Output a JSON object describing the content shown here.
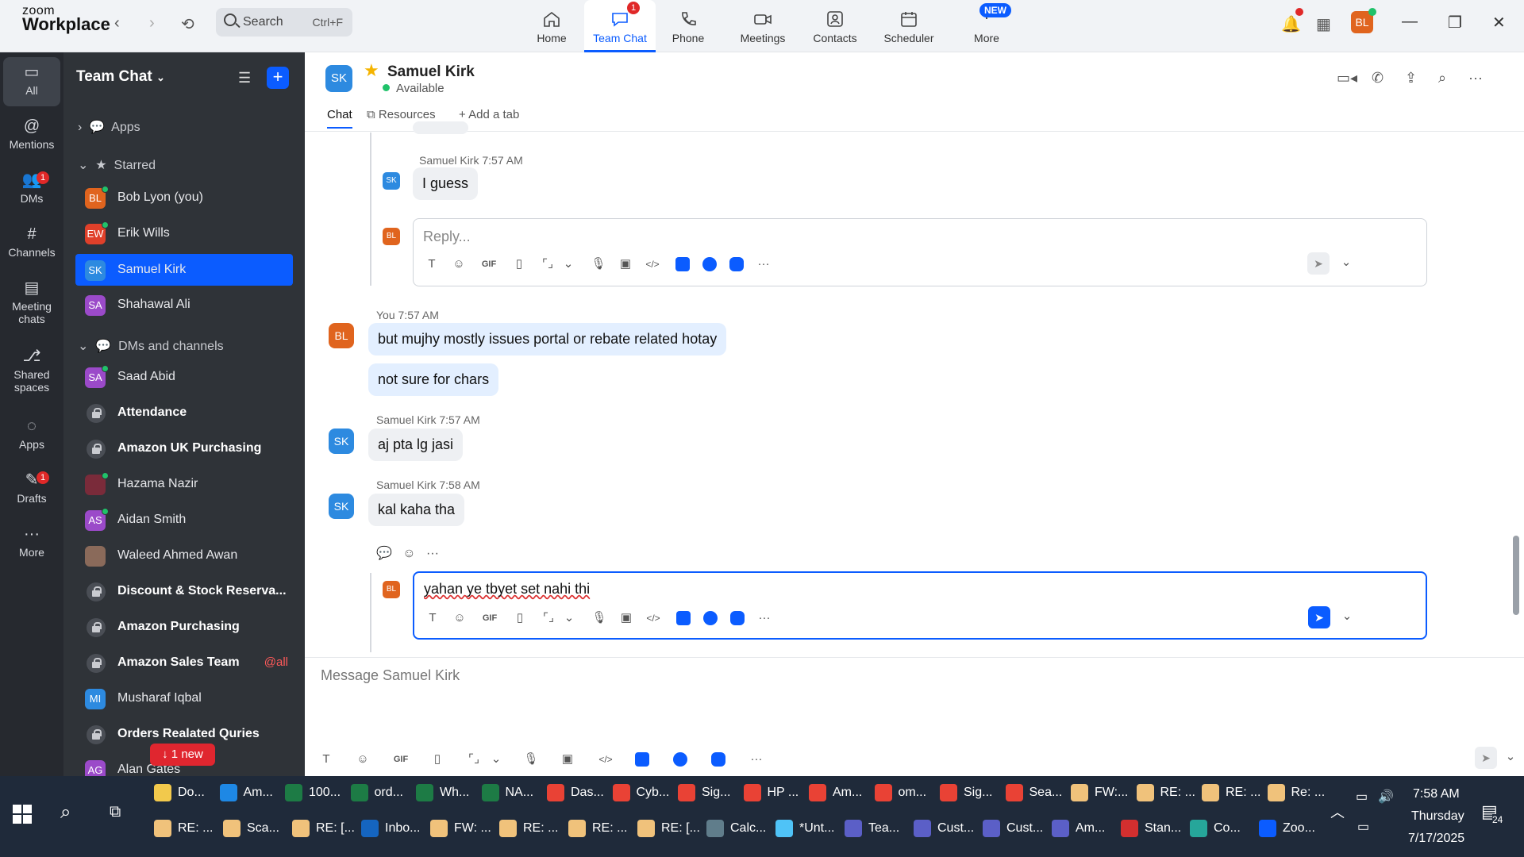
{
  "app": {
    "logo_line1": "zoom",
    "logo_line2": "Workplace"
  },
  "titlebar": {
    "search_label": "Search",
    "search_shortcut": "Ctrl+F",
    "nav": [
      {
        "label": "Home",
        "icon": "home-icon"
      },
      {
        "label": "Team Chat",
        "icon": "chat-icon",
        "badge": "1",
        "active": true
      },
      {
        "label": "Phone",
        "icon": "phone-icon"
      },
      {
        "label": "Meetings",
        "icon": "video-icon"
      },
      {
        "label": "Contacts",
        "icon": "contacts-icon"
      },
      {
        "label": "Scheduler",
        "icon": "calendar-icon"
      },
      {
        "label": "More",
        "icon": "more-icon",
        "new_badge": "NEW"
      }
    ],
    "user_initials": "BL"
  },
  "rail": [
    {
      "label": "All",
      "icon": "chat-icon"
    },
    {
      "label": "Mentions",
      "icon": "at-icon"
    },
    {
      "label": "DMs",
      "icon": "people-icon",
      "badge": "1"
    },
    {
      "label": "Channels",
      "icon": "hash-icon"
    },
    {
      "label": "Meeting chats",
      "icon": "calendar-icon"
    },
    {
      "label": "Shared spaces",
      "icon": "share-icon"
    },
    {
      "label": "Apps",
      "icon": "apps-icon"
    },
    {
      "label": "Drafts",
      "icon": "drafts-icon",
      "badge": "1"
    },
    {
      "label": "More",
      "icon": "more-icon"
    }
  ],
  "sidebar": {
    "title": "Team Chat",
    "sections": {
      "apps": "Apps",
      "starred": "Starred",
      "dms": "DMs and channels"
    },
    "starred": [
      {
        "initials": "BL",
        "name": "Bob Lyon (you)",
        "color": "#e0641e"
      },
      {
        "initials": "EW",
        "name": "Erik Wills",
        "color": "#e0402a"
      },
      {
        "initials": "SK",
        "name": "Samuel Kirk",
        "color": "#2d8ae0"
      },
      {
        "initials": "SA",
        "name": "Shahawal Ali",
        "color": "#9b4ac9"
      }
    ],
    "channels": [
      {
        "initials": "SA",
        "name": "Saad Abid",
        "color": "#9b4ac9"
      },
      {
        "name": "Attendance",
        "lock": true
      },
      {
        "name": "Amazon UK Purchasing",
        "lock": true
      },
      {
        "name": "Hazama Nazir",
        "color": "#7a2b3a"
      },
      {
        "initials": "AS",
        "name": "Aidan Smith",
        "color": "#9b4ac9"
      },
      {
        "name": "Waleed Ahmed Awan",
        "color": "#8a6a5a"
      },
      {
        "name": "Discount & Stock Reserva...",
        "lock": true
      },
      {
        "name": "Amazon Purchasing",
        "lock": true
      },
      {
        "name": "Amazon Sales Team",
        "lock": true,
        "tag": "@all"
      },
      {
        "initials": "MI",
        "name": "Musharaf Iqbal",
        "color": "#2d8ae0"
      },
      {
        "name": "Orders Realated Quries",
        "lock": true
      },
      {
        "initials": "AG",
        "name": "Alan Gates",
        "color": "#9b4ac9"
      }
    ],
    "new_pill": "↓ 1 new"
  },
  "chat": {
    "contact": {
      "initials": "SK",
      "name": "Samuel Kirk",
      "status": "Available"
    },
    "tabs": [
      "Chat",
      "Resources",
      "Add a tab"
    ],
    "thread": [
      {
        "sender": "Samuel Kirk",
        "time": "7:57 AM",
        "initials": "SK",
        "text": "I guess"
      }
    ],
    "reply_placeholder": "Reply...",
    "messages": [
      {
        "sender": "You",
        "time": "7:57 AM",
        "initials": "BL",
        "texts": [
          "but mujhy mostly issues portal or rebate related hotay",
          "not sure for chars"
        ],
        "mine": true
      },
      {
        "sender": "Samuel Kirk",
        "time": "7:57 AM",
        "initials": "SK",
        "texts": [
          "aj pta lg jasi"
        ]
      },
      {
        "sender": "Samuel Kirk",
        "time": "7:58 AM",
        "initials": "SK",
        "texts": [
          "kal kaha tha"
        ]
      }
    ],
    "reply_draft": "yahan ye tbyet set nahi thi ",
    "composer_placeholder": "Message Samuel Kirk",
    "toolbar": {
      "text": "T",
      "emoji": "☺",
      "gif": "GIF",
      "file": "▯",
      "screenshot": "⌜⌟",
      "audio": "🎙",
      "video": "▣",
      "code": "</>",
      "more": "···"
    }
  },
  "taskbar": {
    "row1": [
      {
        "label": "Do...",
        "color": "#f2c94c"
      },
      {
        "label": "Am...",
        "color": "#1e88e5"
      },
      {
        "label": "100...",
        "color": "#1d7b45"
      },
      {
        "label": "ord...",
        "color": "#1d7b45"
      },
      {
        "label": "Wh...",
        "color": "#1d7b45"
      },
      {
        "label": "NA...",
        "color": "#1d7b45"
      },
      {
        "label": "Das...",
        "color": "#e94235"
      },
      {
        "label": "Cyb...",
        "color": "#e94235"
      },
      {
        "label": "Sig...",
        "color": "#e94235"
      },
      {
        "label": "HP ...",
        "color": "#e94235"
      },
      {
        "label": "Am...",
        "color": "#e94235"
      },
      {
        "label": "om...",
        "color": "#e94235"
      },
      {
        "label": "Sig...",
        "color": "#e94235"
      },
      {
        "label": "Sea...",
        "color": "#e94235"
      },
      {
        "label": "FW:...",
        "color": "#f0c27b"
      },
      {
        "label": "RE: ...",
        "color": "#f0c27b"
      },
      {
        "label": "RE: ...",
        "color": "#f0c27b"
      },
      {
        "label": "Re: ...",
        "color": "#f0c27b"
      }
    ],
    "row2": [
      {
        "label": "RE: ...",
        "color": "#f0c27b"
      },
      {
        "label": "Sca...",
        "color": "#f0c27b"
      },
      {
        "label": "RE: [...",
        "color": "#f0c27b"
      },
      {
        "label": "Inbo...",
        "color": "#1565c0"
      },
      {
        "label": "FW: ...",
        "color": "#f0c27b"
      },
      {
        "label": "RE: ...",
        "color": "#f0c27b"
      },
      {
        "label": "RE: ...",
        "color": "#f0c27b"
      },
      {
        "label": "RE: [...",
        "color": "#f0c27b"
      },
      {
        "label": "Calc...",
        "color": "#607d8b"
      },
      {
        "label": "*Unt...",
        "color": "#4fc3f7"
      },
      {
        "label": "Tea...",
        "color": "#5b5fc7"
      },
      {
        "label": "Cust...",
        "color": "#5b5fc7"
      },
      {
        "label": "Cust...",
        "color": "#5b5fc7"
      },
      {
        "label": "Am...",
        "color": "#5b5fc7"
      },
      {
        "label": "Stan...",
        "color": "#d32f2f"
      },
      {
        "label": "Co...",
        "color": "#26a69a"
      },
      {
        "label": "Zoo...",
        "color": "#0b5cff"
      }
    ],
    "clock": {
      "time": "7:58 AM",
      "day": "Thursday",
      "date": "7/17/2025"
    },
    "notif_count": "24"
  }
}
